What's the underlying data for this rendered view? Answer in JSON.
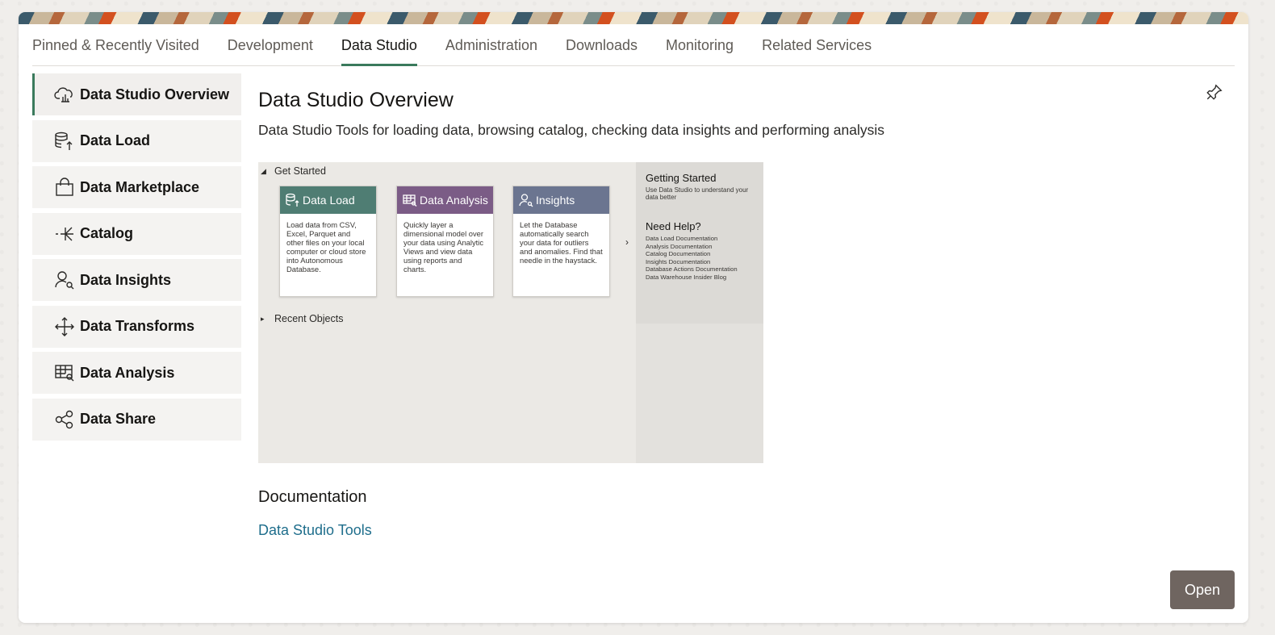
{
  "tabs": [
    {
      "label": "Pinned & Recently Visited"
    },
    {
      "label": "Development"
    },
    {
      "label": "Data Studio"
    },
    {
      "label": "Administration"
    },
    {
      "label": "Downloads"
    },
    {
      "label": "Monitoring"
    },
    {
      "label": "Related Services"
    }
  ],
  "active_tab": "Data Studio",
  "sidebar": {
    "items": [
      {
        "label": "Data Studio Overview",
        "icon": "cloud-chart-icon"
      },
      {
        "label": "Data Load",
        "icon": "database-upload-icon"
      },
      {
        "label": "Data Marketplace",
        "icon": "shopping-bag-icon"
      },
      {
        "label": "Catalog",
        "icon": "catalog-icon"
      },
      {
        "label": "Data Insights",
        "icon": "person-search-icon"
      },
      {
        "label": "Data Transforms",
        "icon": "move-arrows-icon"
      },
      {
        "label": "Data Analysis",
        "icon": "table-search-icon"
      },
      {
        "label": "Data Share",
        "icon": "share-icon"
      }
    ]
  },
  "main": {
    "title": "Data Studio Overview",
    "subtitle": "Data Studio Tools for loading data, browsing catalog, checking data insights and performing analysis",
    "pin_icon": "pin-icon",
    "documentation_heading": "Documentation",
    "documentation_link": "Data Studio Tools",
    "open_button": "Open"
  },
  "preview": {
    "get_started": "Get Started",
    "recent_objects": "Recent Objects",
    "tiles": [
      {
        "title": "Data Load",
        "color": "#4f7d73",
        "body": "Load data from CSV, Excel, Parquet and other files on your local computer or cloud store into Autonomous Database."
      },
      {
        "title": "Data Analysis",
        "color": "#7b5c86",
        "body": "Quickly layer a dimensional model over your data using Analytic Views and view data using reports and charts."
      },
      {
        "title": "Insights",
        "color": "#6b7590",
        "body": "Let the Database automatically search your data for outliers and anomalies. Find that needle in the haystack."
      }
    ],
    "getting_started_title": "Getting Started",
    "getting_started_sub": "Use Data Studio to understand your data better",
    "need_help_title": "Need Help?",
    "help_links": [
      "Data Load Documentation",
      "Analysis Documentation",
      "Catalog Documentation",
      "Insights Documentation",
      "Database Actions Documentation",
      "Data Warehouse Insider Blog"
    ]
  },
  "colors": {
    "accent": "#3a7a5c",
    "link": "#1f6e8c",
    "button": "#6f6560"
  }
}
